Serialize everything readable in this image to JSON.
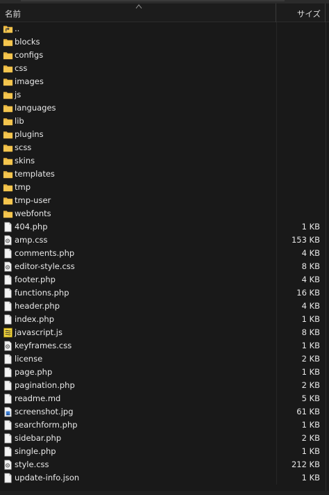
{
  "header": {
    "name_label": "名前",
    "size_label": "サイズ"
  },
  "files": [
    {
      "name": "..",
      "size": "",
      "icon": "parent-folder-icon"
    },
    {
      "name": "blocks",
      "size": "",
      "icon": "folder-icon"
    },
    {
      "name": "configs",
      "size": "",
      "icon": "folder-icon"
    },
    {
      "name": "css",
      "size": "",
      "icon": "folder-icon"
    },
    {
      "name": "images",
      "size": "",
      "icon": "folder-icon"
    },
    {
      "name": "js",
      "size": "",
      "icon": "folder-icon"
    },
    {
      "name": "languages",
      "size": "",
      "icon": "folder-icon"
    },
    {
      "name": "lib",
      "size": "",
      "icon": "folder-icon"
    },
    {
      "name": "plugins",
      "size": "",
      "icon": "folder-icon"
    },
    {
      "name": "scss",
      "size": "",
      "icon": "folder-icon"
    },
    {
      "name": "skins",
      "size": "",
      "icon": "folder-icon"
    },
    {
      "name": "templates",
      "size": "",
      "icon": "folder-icon"
    },
    {
      "name": "tmp",
      "size": "",
      "icon": "folder-icon"
    },
    {
      "name": "tmp-user",
      "size": "",
      "icon": "folder-icon"
    },
    {
      "name": "webfonts",
      "size": "",
      "icon": "folder-icon"
    },
    {
      "name": "404.php",
      "size": "1 KB",
      "icon": "file-icon"
    },
    {
      "name": "amp.css",
      "size": "153 KB",
      "icon": "css-file-icon"
    },
    {
      "name": "comments.php",
      "size": "4 KB",
      "icon": "file-icon"
    },
    {
      "name": "editor-style.css",
      "size": "8 KB",
      "icon": "css-file-icon"
    },
    {
      "name": "footer.php",
      "size": "4 KB",
      "icon": "file-icon"
    },
    {
      "name": "functions.php",
      "size": "16 KB",
      "icon": "file-icon"
    },
    {
      "name": "header.php",
      "size": "4 KB",
      "icon": "file-icon"
    },
    {
      "name": "index.php",
      "size": "1 KB",
      "icon": "file-icon"
    },
    {
      "name": "javascript.js",
      "size": "8 KB",
      "icon": "js-file-icon"
    },
    {
      "name": "keyframes.css",
      "size": "1 KB",
      "icon": "css-file-icon"
    },
    {
      "name": "license",
      "size": "2 KB",
      "icon": "file-icon"
    },
    {
      "name": "page.php",
      "size": "1 KB",
      "icon": "file-icon"
    },
    {
      "name": "pagination.php",
      "size": "2 KB",
      "icon": "file-icon"
    },
    {
      "name": "readme.md",
      "size": "5 KB",
      "icon": "file-icon"
    },
    {
      "name": "screenshot.jpg",
      "size": "61 KB",
      "icon": "image-file-icon"
    },
    {
      "name": "searchform.php",
      "size": "1 KB",
      "icon": "file-icon"
    },
    {
      "name": "sidebar.php",
      "size": "2 KB",
      "icon": "file-icon"
    },
    {
      "name": "single.php",
      "size": "1 KB",
      "icon": "file-icon"
    },
    {
      "name": "style.css",
      "size": "212 KB",
      "icon": "css-file-icon"
    },
    {
      "name": "update-info.json",
      "size": "1 KB",
      "icon": "file-icon"
    }
  ],
  "colors": {
    "background": "#191919",
    "folder": "#f4c54e",
    "text": "#e8e8e8"
  }
}
